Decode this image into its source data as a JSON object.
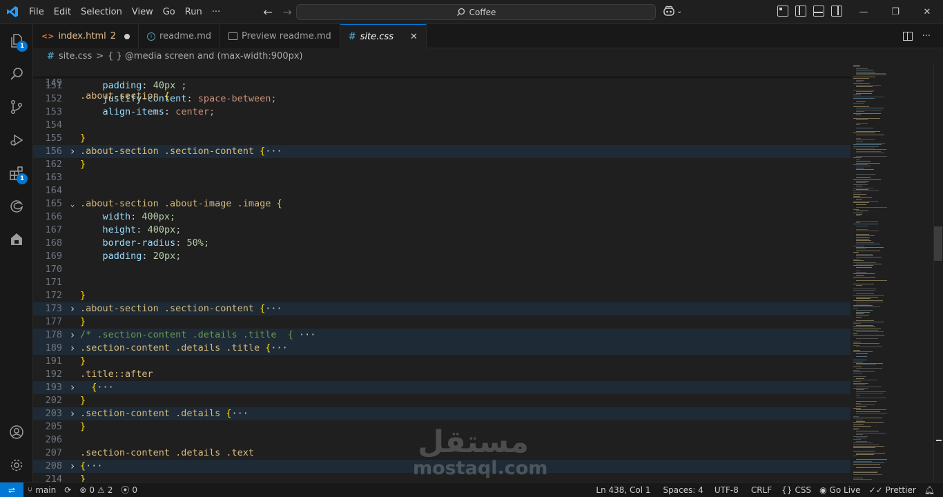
{
  "menu": [
    "File",
    "Edit",
    "Selection",
    "View",
    "Go",
    "Run",
    "···"
  ],
  "search": {
    "text": "Coffee"
  },
  "tabs": [
    {
      "label": "index.html",
      "modified": "2",
      "icon": "html-icon"
    },
    {
      "label": "readme.md",
      "icon": "info-icon"
    },
    {
      "label": "Preview readme.md",
      "icon": "preview-icon"
    },
    {
      "label": "site.css",
      "icon": "css-hash-icon"
    }
  ],
  "breadcrumb": {
    "file": "site.css",
    "separator": ">",
    "symbol": "{ } @media screen and (max-width:900px)"
  },
  "activity_badges": {
    "explorer": "1",
    "extensions": "1"
  },
  "code": {
    "sticky": {
      "ln": "149",
      "text": ".about-section {"
    },
    "lines": [
      {
        "ln": "151",
        "prop": "padding",
        "val": "40px ;",
        "vclass": "num"
      },
      {
        "ln": "152",
        "prop": "justify-content",
        "val": "space-between;",
        "vclass": "val"
      },
      {
        "ln": "153",
        "prop": "align-items",
        "val": "center;",
        "vclass": "val"
      },
      {
        "ln": "154"
      },
      {
        "ln": "155",
        "brace": "}"
      },
      {
        "ln": "156",
        "sel": ".about-section .section-content",
        "fold": true,
        "folded": true
      },
      {
        "ln": "162",
        "brace": "}"
      },
      {
        "ln": "163"
      },
      {
        "ln": "164"
      },
      {
        "ln": "165",
        "sel": ".about-section .about-image .image",
        "fold": true,
        "open": true
      },
      {
        "ln": "166",
        "prop": "width",
        "val": "400px;",
        "vclass": "num"
      },
      {
        "ln": "167",
        "prop": "height",
        "val": "400px;",
        "vclass": "num"
      },
      {
        "ln": "168",
        "prop": "border-radius",
        "val": "50%;",
        "vclass": "num"
      },
      {
        "ln": "169",
        "prop": "padding",
        "val": "20px;",
        "vclass": "num"
      },
      {
        "ln": "170"
      },
      {
        "ln": "171"
      },
      {
        "ln": "172",
        "brace": "}"
      },
      {
        "ln": "173",
        "sel": ".about-section .section-content",
        "fold": true,
        "folded": true
      },
      {
        "ln": "177",
        "brace": "}"
      },
      {
        "ln": "178",
        "comment": "/* .section-content .details .title  {",
        "fold": true,
        "folded": true
      },
      {
        "ln": "189",
        "sel": ".section-content .details .title",
        "fold": true,
        "folded": true
      },
      {
        "ln": "191",
        "brace": "}"
      },
      {
        "ln": "192",
        "plainsel": ".title::after"
      },
      {
        "ln": "193",
        "indentbrace": "  {",
        "fold": true,
        "folded": true
      },
      {
        "ln": "202",
        "brace": "}"
      },
      {
        "ln": "203",
        "sel": ".section-content .details",
        "fold": true,
        "folded": true
      },
      {
        "ln": "205",
        "brace": "}"
      },
      {
        "ln": "206"
      },
      {
        "ln": "207",
        "plainsel": ".section-content .details .text"
      },
      {
        "ln": "208",
        "indentbrace": "{",
        "fold": true,
        "folded": true
      },
      {
        "ln": "214",
        "brace": "}"
      }
    ]
  },
  "statusbar": {
    "branch": "main",
    "errors": "0",
    "warnings": "2",
    "ports": "0",
    "position": "Ln 438, Col 1",
    "spaces": "Spaces: 4",
    "encoding": "UTF-8",
    "eol": "CRLF",
    "language": "CSS",
    "golive": "Go Live",
    "prettier": "Prettier"
  },
  "watermark": {
    "arabic": "مستقل",
    "latin": "mostaql.com"
  }
}
